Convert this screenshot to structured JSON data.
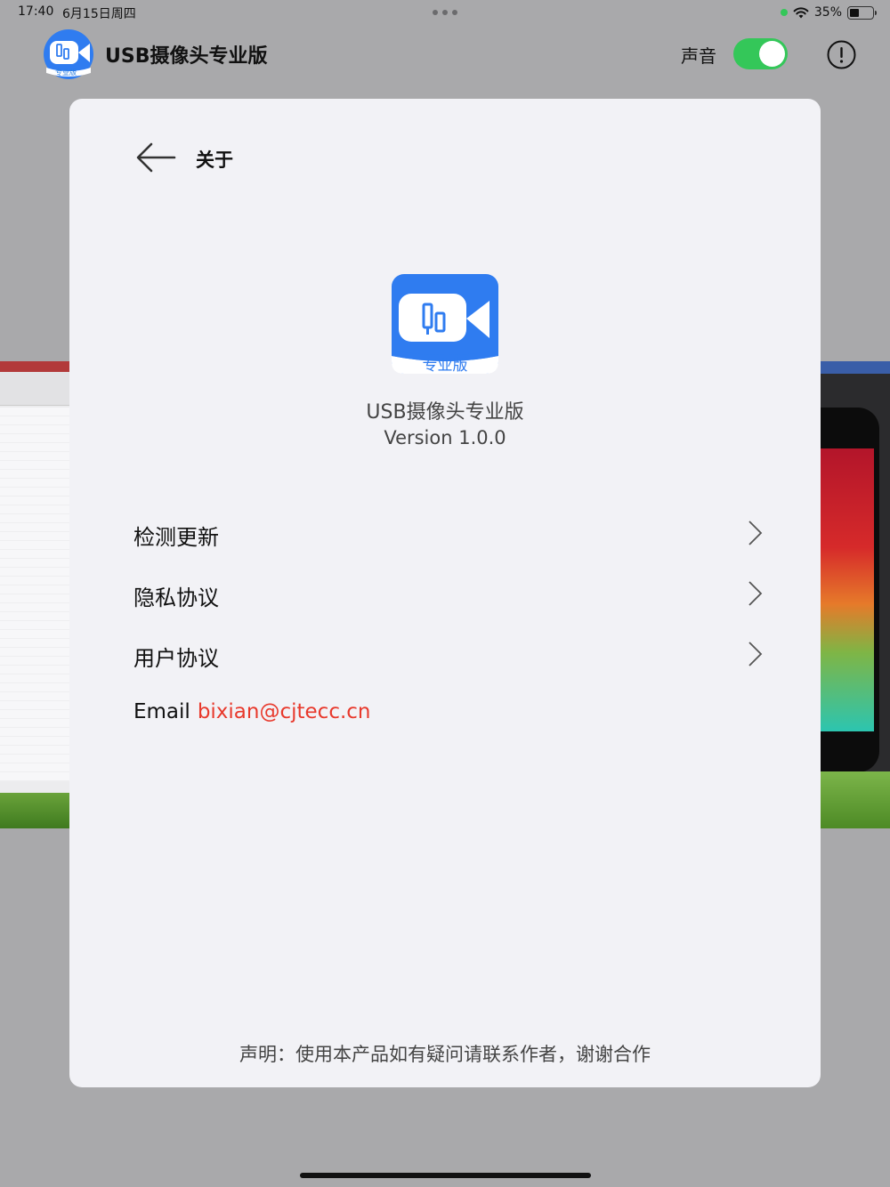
{
  "status_bar": {
    "time": "17:40",
    "date": "6月15日周四",
    "battery": "35%"
  },
  "app_header": {
    "title": "USB摄像头专业版",
    "logo_caption": "专业版",
    "sound_label": "声音",
    "sound_enabled": true
  },
  "about": {
    "title": "关于",
    "app_name": "USB摄像头专业版",
    "version": "Version 1.0.0",
    "logo_caption": "专业版",
    "menu": [
      {
        "label": "检测更新"
      },
      {
        "label": "隐私协议"
      },
      {
        "label": "用户协议"
      }
    ],
    "email_label": "Email",
    "email_value": "bixian@cjtecc.cn",
    "disclaimer": "声明：使用本产品如有疑问请联系作者，谢谢合作"
  },
  "colors": {
    "accent_blue": "#2f7cf0",
    "toggle_on": "#34c759",
    "email_red": "#e8392c"
  },
  "icons": {
    "back": "arrow-left-icon",
    "chevron": "chevron-right-icon",
    "info": "info-circle-icon",
    "logo": "camera-usb-icon"
  }
}
